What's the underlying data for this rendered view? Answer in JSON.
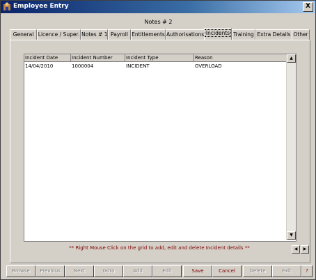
{
  "window": {
    "title": "Employee Entry",
    "close_glyph": "X"
  },
  "pane": {
    "title": "Notes # 2"
  },
  "tabs": [
    {
      "label": "General"
    },
    {
      "label": "Licence / Super."
    },
    {
      "label": "Notes # 1"
    },
    {
      "label": "Payroll"
    },
    {
      "label": "Entitlements"
    },
    {
      "label": "Authorisations"
    },
    {
      "label": "Incidents",
      "active": true
    },
    {
      "label": "Training"
    },
    {
      "label": "Extra Details"
    },
    {
      "label": "Other"
    }
  ],
  "grid": {
    "columns": [
      "Incident Date",
      "Incident Number",
      "Incident Type",
      "Reason"
    ],
    "rows": [
      [
        "14/04/2010",
        "1000004",
        "INCIDENT",
        "OVERLOAD"
      ]
    ]
  },
  "hint": "** Right Mouse Click on the grid to add, edit and delete Incident details **",
  "toolbar": {
    "buttons": [
      {
        "label": "Browse",
        "enabled": false
      },
      {
        "label": "Previous",
        "enabled": false
      },
      {
        "label": "Next",
        "enabled": false
      },
      {
        "label": "Goto",
        "enabled": false
      },
      {
        "label": "Add",
        "enabled": false
      },
      {
        "label": "Edit",
        "enabled": false
      },
      {
        "label": "Save",
        "enabled": true
      },
      {
        "label": "Cancel",
        "enabled": true
      },
      {
        "label": "Delete",
        "enabled": false
      },
      {
        "label": "Exit",
        "enabled": false
      },
      {
        "label": "?",
        "enabled": true
      }
    ]
  },
  "colors": {
    "accent_text": "#800000",
    "title_bar": "#0a246a"
  }
}
